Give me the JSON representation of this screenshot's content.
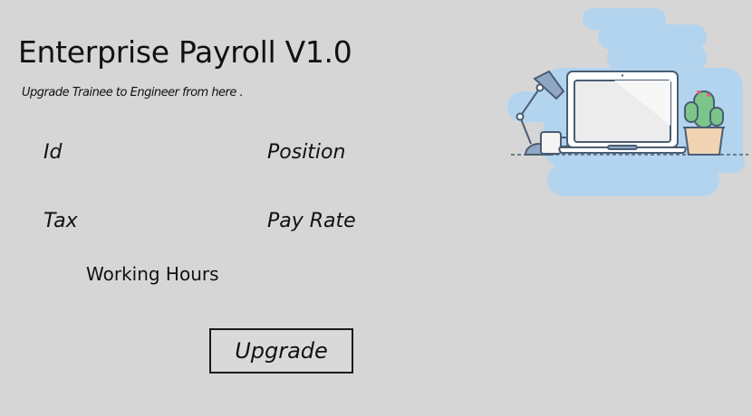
{
  "app": {
    "title": "Enterprise Payroll V1.0",
    "subtitle": "Upgrade Trainee to Engineer from here ."
  },
  "form": {
    "id_label": "Id",
    "position_label": "Position",
    "tax_label": "Tax",
    "pay_rate_label": "Pay Rate",
    "working_hours_label": "Working Hours"
  },
  "actions": {
    "upgrade_label": "Upgrade"
  },
  "illustration": {
    "name": "laptop-desk-illustration",
    "colors": {
      "cloud": "#b3d4ef",
      "laptop_frame": "#ffffff",
      "laptop_screen": "#ececec",
      "outline": "#4a5d72",
      "cactus": "#7cc58a",
      "pot": "#f2d3b3",
      "lamp": "#8fa7c4"
    }
  }
}
